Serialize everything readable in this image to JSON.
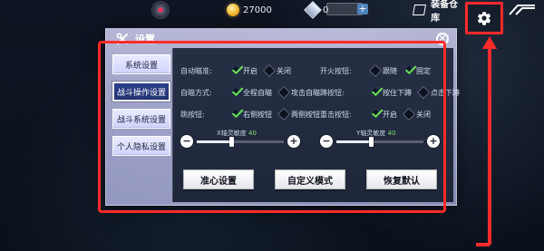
{
  "hud": {
    "coins": "27000",
    "gems": "0",
    "warehouse": "装备仓库"
  },
  "dialog": {
    "title": "设置",
    "close_glyph": "×"
  },
  "sidebar": {
    "items": [
      {
        "label": "系统设置",
        "active": false
      },
      {
        "label": "战斗操作设置",
        "active": true
      },
      {
        "label": "战斗系统设置",
        "active": false
      },
      {
        "label": "个人隐私设置",
        "active": false
      }
    ]
  },
  "settings": {
    "left": [
      {
        "label": "自动瞄准:",
        "options": [
          {
            "label": "开启",
            "checked": true
          },
          {
            "label": "关闭",
            "checked": false
          }
        ]
      },
      {
        "label": "自瞄方式:",
        "options": [
          {
            "label": "全程自瞄",
            "checked": true
          },
          {
            "label": "攻击自瞄",
            "checked": false
          }
        ]
      },
      {
        "label": "跳按钮:",
        "options": [
          {
            "label": "右侧按钮",
            "checked": true
          },
          {
            "label": "两侧按钮",
            "checked": false
          }
        ]
      }
    ],
    "right": [
      {
        "label": "开火按钮:",
        "options": [
          {
            "label": "跟随",
            "checked": false
          },
          {
            "label": "固定",
            "checked": true
          }
        ]
      },
      {
        "label": "蹲按钮:",
        "options": [
          {
            "label": "按住下蹲",
            "checked": true
          },
          {
            "label": "点击下蹲",
            "checked": false
          }
        ]
      },
      {
        "label": "重击按钮:",
        "options": [
          {
            "label": "开启",
            "checked": true
          },
          {
            "label": "关闭",
            "checked": false
          }
        ]
      }
    ]
  },
  "sliders": {
    "x": {
      "label": "X轴灵敏度",
      "value": "40",
      "fraction": 0.4
    },
    "y": {
      "label": "Y轴灵敏度",
      "value": "40",
      "fraction": 0.4
    }
  },
  "buttons": {
    "crosshair": "准心设置",
    "custom": "自定义模式",
    "reset": "恢复默认"
  },
  "colors": {
    "highlight": "#ff2b2b",
    "accent_green": "#7be06b",
    "active_tab": "#2a3e8b"
  }
}
